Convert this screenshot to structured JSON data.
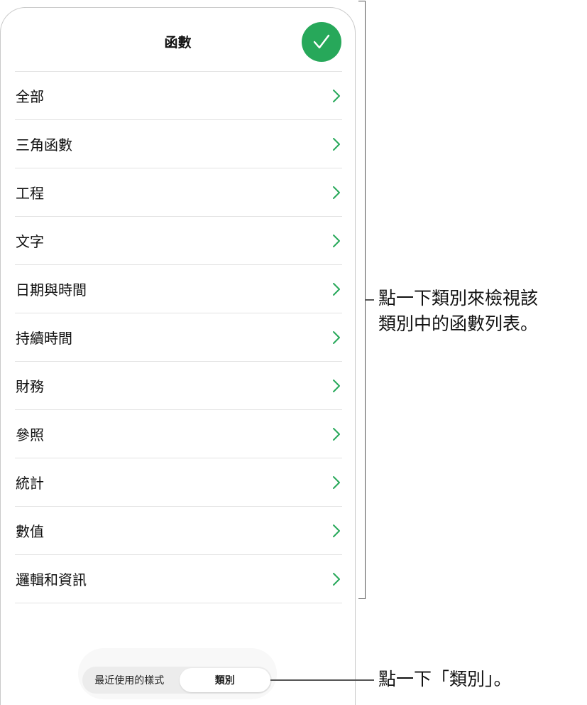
{
  "sheet": {
    "title": "函數",
    "done_icon": "checkmark-icon"
  },
  "categories": [
    {
      "label": "全部"
    },
    {
      "label": "三角函數"
    },
    {
      "label": "工程"
    },
    {
      "label": "文字"
    },
    {
      "label": "日期與時間"
    },
    {
      "label": "持續時間"
    },
    {
      "label": "財務"
    },
    {
      "label": "參照"
    },
    {
      "label": "統計"
    },
    {
      "label": "數值"
    },
    {
      "label": "邏輯和資訊"
    }
  ],
  "segmented": {
    "recent_label": "最近使用的樣式",
    "category_label": "類別",
    "selected": "類別"
  },
  "callouts": {
    "list_note_line1": "點一下類別來檢視該",
    "list_note_line2": "類別中的函數列表。",
    "segment_note": "點一下「類別」。"
  },
  "colors": {
    "accent_green": "#27a85a",
    "chevron_green": "#27a85a"
  }
}
